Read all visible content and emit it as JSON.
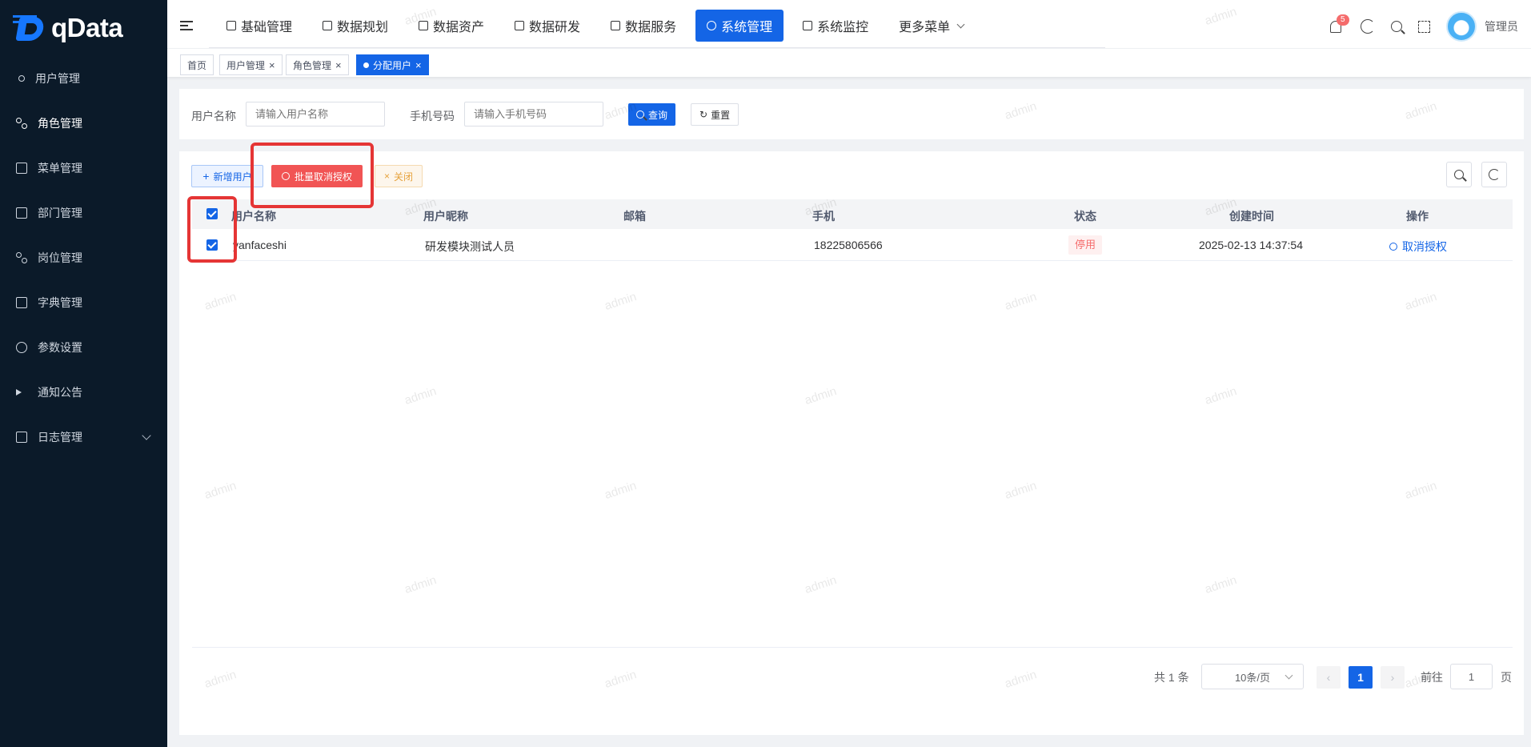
{
  "sidebar": {
    "logo_text": "qData",
    "items": [
      {
        "label": "用户管理",
        "icon": "user-icon"
      },
      {
        "label": "角色管理",
        "icon": "role-icon"
      },
      {
        "label": "菜单管理",
        "icon": "menu-icon"
      },
      {
        "label": "部门管理",
        "icon": "dept-icon"
      },
      {
        "label": "岗位管理",
        "icon": "post-icon"
      },
      {
        "label": "字典管理",
        "icon": "dict-icon"
      },
      {
        "label": "参数设置",
        "icon": "settings-icon"
      },
      {
        "label": "通知公告",
        "icon": "megaphone-icon"
      },
      {
        "label": "日志管理",
        "icon": "log-icon"
      }
    ]
  },
  "topnav": {
    "items": [
      "基础管理",
      "数据规划",
      "数据资产",
      "数据研发",
      "数据服务",
      "系统管理",
      "系统监控",
      "更多菜单"
    ],
    "active": "系统管理",
    "notification_count": "5",
    "user_name": "管理员"
  },
  "tags": {
    "items": [
      "首页",
      "用户管理",
      "角色管理",
      "分配用户"
    ],
    "active": "分配用户"
  },
  "search": {
    "username_label": "用户名称",
    "username_placeholder": "请输入用户名称",
    "phone_label": "手机号码",
    "phone_placeholder": "请输入手机号码",
    "query_label": "查询",
    "reset_label": "重置"
  },
  "toolbar": {
    "add_label": "新增用户",
    "batch_revoke_label": "批量取消授权",
    "close_label": "关闭"
  },
  "table": {
    "columns": [
      "用户名称",
      "用户昵称",
      "邮箱",
      "手机",
      "状态",
      "创建时间",
      "操作"
    ],
    "rows": [
      {
        "username": "yanfaceshi",
        "nickname": "研发模块测试人员",
        "email": "",
        "phone": "18225806566",
        "status": "停用",
        "created": "2025-02-13 14:37:54",
        "action": "取消授权"
      }
    ]
  },
  "pagination": {
    "total": "共 1 条",
    "page_size": "10条/页",
    "current_page": "1",
    "goto_label": "前往",
    "goto_value": "1",
    "page_suffix": "页"
  },
  "watermark": "admin",
  "colors": {
    "primary": "#1465e6",
    "sidebar_bg": "#0b1a29",
    "danger": "#f15454",
    "highlight": "#e53535"
  }
}
